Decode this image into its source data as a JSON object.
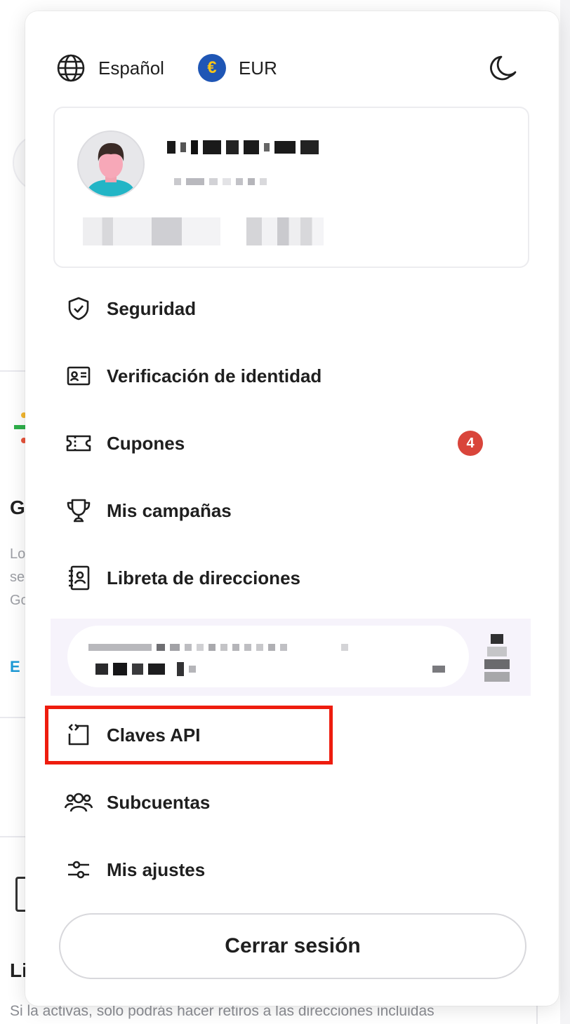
{
  "header": {
    "language_label": "Español",
    "currency_label": "EUR",
    "currency_symbol": "€",
    "theme_toggle_icon": "moon-icon"
  },
  "profile": {
    "avatar_icon": "user-avatar"
  },
  "menu": {
    "items": [
      {
        "label": "Seguridad",
        "icon": "shield-check-icon"
      },
      {
        "label": "Verificación de identidad",
        "icon": "id-card-icon"
      },
      {
        "label": "Cupones",
        "icon": "ticket-icon",
        "badge": "4"
      },
      {
        "label": "Mis campañas",
        "icon": "trophy-icon"
      },
      {
        "label": "Libreta de direcciones",
        "icon": "address-book-icon"
      },
      {
        "label": "Claves API",
        "icon": "code-bracket-icon"
      },
      {
        "label": "Subcuentas",
        "icon": "users-icon"
      },
      {
        "label": "Mis ajustes",
        "icon": "sliders-icon"
      }
    ]
  },
  "logout": {
    "label": "Cerrar sesión"
  },
  "background": {
    "heading_1": "G",
    "text_lines": [
      "Lo",
      "se",
      "Go"
    ],
    "link": "E",
    "heading_2": "Li",
    "bottom_text": "Si la activas, solo podrás hacer retiros a las direcciones incluidas"
  },
  "colors": {
    "badge": "#d9453b",
    "highlight_border": "#ee1c0e",
    "currency_bg": "#1f56b5",
    "currency_fg": "#f7c518",
    "promo_bg": "#f6f3fb"
  }
}
